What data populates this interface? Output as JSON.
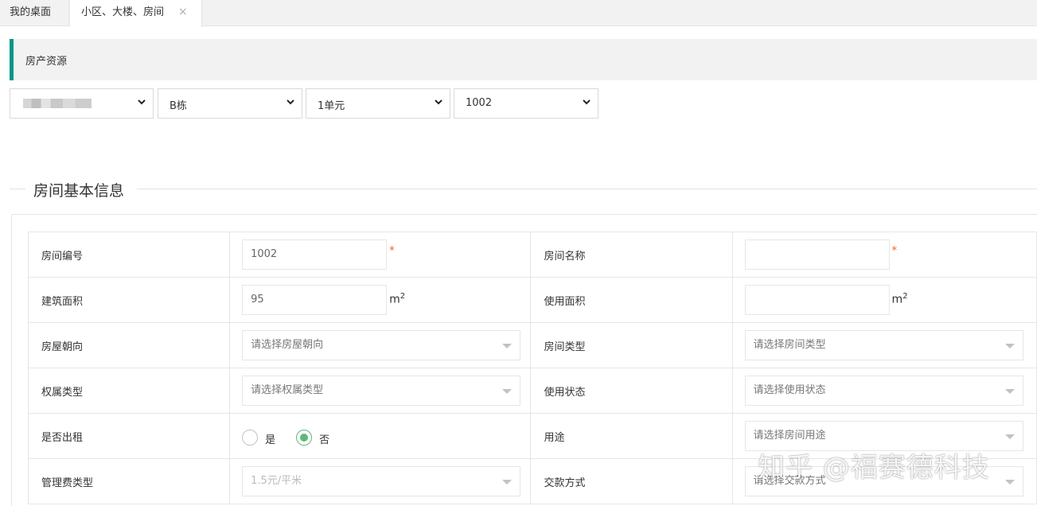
{
  "tabs": [
    {
      "label": "我的桌面"
    },
    {
      "label": "小区、大楼、房间",
      "close": "×"
    }
  ],
  "header": {
    "title": "房产资源"
  },
  "selects": {
    "community": "",
    "building": "B栋",
    "unit": "1单元",
    "room": "1002"
  },
  "section": {
    "title": "房间基本信息"
  },
  "form": {
    "room_no": {
      "label": "房间编号",
      "value": "1002",
      "required": "*"
    },
    "room_name": {
      "label": "房间名称",
      "value": "",
      "required": "*"
    },
    "build_area": {
      "label": "建筑面积",
      "value": "95",
      "unit": "m",
      "unit_sup": "2"
    },
    "use_area": {
      "label": "使用面积",
      "value": "",
      "unit": "m",
      "unit_sup": "2"
    },
    "orientation": {
      "label": "房屋朝向",
      "placeholder": "请选择房屋朝向"
    },
    "room_type": {
      "label": "房间类型",
      "placeholder": "请选择房间类型"
    },
    "ownership": {
      "label": "权属类型",
      "placeholder": "请选择权属类型"
    },
    "use_status": {
      "label": "使用状态",
      "placeholder": "请选择使用状态"
    },
    "rented": {
      "label": "是否出租",
      "yes": "是",
      "no": "否",
      "selected": "否"
    },
    "purpose": {
      "label": "用途",
      "placeholder": "请选择房间用途"
    },
    "fee_type": {
      "label": "管理费类型",
      "value": "1.5元/平米"
    },
    "payment": {
      "label": "交款方式",
      "placeholder": "请选择交款方式"
    }
  },
  "watermark": "知乎 @福赛德科技",
  "colors": {
    "accent": "#009688",
    "radio": "#5fb878",
    "required": "#ff5722"
  }
}
